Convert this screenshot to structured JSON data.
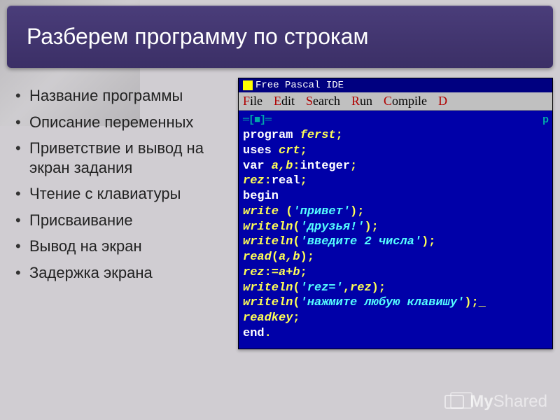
{
  "title": "Разберем программу по строкам",
  "bullets": [
    "Название программы",
    "Описание переменных",
    "Приветствие и вывод на экран задания",
    "Чтение с клавиатуры",
    "Присваивание",
    "Вывод на экран",
    "Задержка экрана"
  ],
  "ide": {
    "window_title": "Free Pascal IDE",
    "menu": {
      "file": {
        "hotkey": "F",
        "rest": "ile"
      },
      "edit": {
        "hotkey": "E",
        "rest": "dit"
      },
      "search": {
        "hotkey": "S",
        "rest": "earch"
      },
      "run": {
        "hotkey": "R",
        "rest": "un"
      },
      "compile": {
        "hotkey": "C",
        "rest": "ompile"
      },
      "debug": {
        "hotkey": "D",
        "rest": ""
      }
    },
    "frame_left": "═[■]═",
    "frame_right": "p",
    "code": {
      "l1_kw": "program",
      "l1_id": " ferst",
      "l1_sym": ";",
      "l2_kw": "uses",
      "l2_id": " crt",
      "l2_sym": ";",
      "l3_kw": "var",
      "l3_id": " a,b",
      "l3_sym1": ":",
      "l3_type": "integer",
      "l3_sym2": ";",
      "l4_id": "rez",
      "l4_sym1": ":",
      "l4_type": "real",
      "l4_sym2": ";",
      "l5_kw": "begin",
      "l6_id": "write ",
      "l6_s1": "(",
      "l6_str": "'привет'",
      "l6_s2": ");",
      "l7_id": "writeln",
      "l7_s1": "(",
      "l7_str": "'друзья!'",
      "l7_s2": ");",
      "l8_id": "writeln",
      "l8_s1": "(",
      "l8_str": "'введите 2 числа'",
      "l8_s2": ");",
      "l9_id": "read",
      "l9_s1": "(",
      "l9_args": "a,b",
      "l9_s2": ");",
      "l10_id": "rez",
      "l10_op": ":=",
      "l10_expr": "a+b",
      "l10_sym": ";",
      "l11_id": "writeln",
      "l11_s1": "(",
      "l11_str": "'rez='",
      "l11_sep": ",",
      "l11_arg": "rez",
      "l11_s2": ");",
      "l12_id": "writeln",
      "l12_s1": "(",
      "l12_str": "'нажмите любую клавишу'",
      "l12_s2": ");",
      "l12_cursor": "_",
      "l13_id": "readkey",
      "l13_sym": ";",
      "l14_kw": "end",
      "l14_sym": "."
    }
  },
  "watermark": {
    "my": "My",
    "shared": "Shared"
  }
}
